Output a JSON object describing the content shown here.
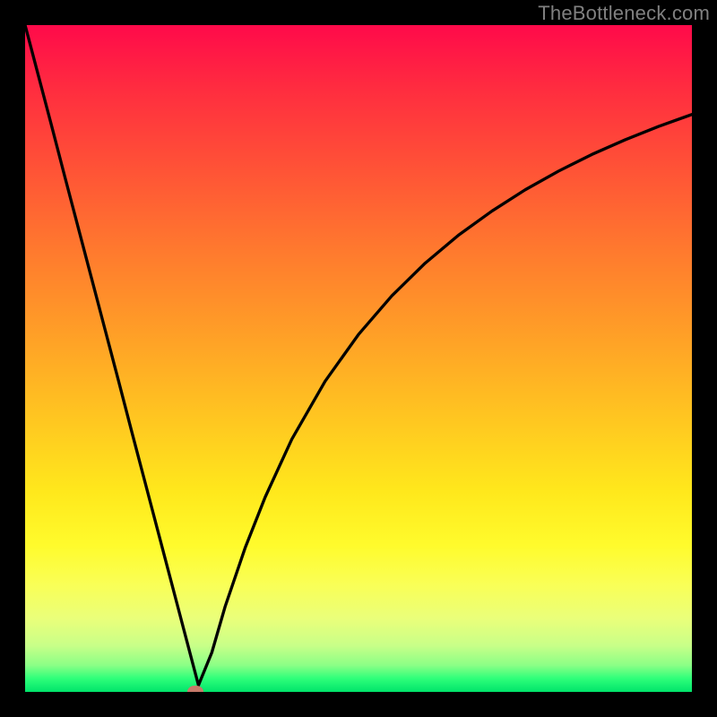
{
  "watermark": "TheBottleneck.com",
  "chart_data": {
    "type": "line",
    "title": "",
    "xlabel": "",
    "ylabel": "",
    "xlim": [
      0,
      100
    ],
    "ylim": [
      0,
      100
    ],
    "x": [
      0,
      2,
      4,
      6,
      8,
      10,
      12,
      14,
      16,
      18,
      20,
      21,
      22,
      23,
      24,
      25,
      26,
      28,
      30,
      33,
      36,
      40,
      45,
      50,
      55,
      60,
      65,
      70,
      75,
      80,
      85,
      90,
      95,
      100
    ],
    "values": [
      100,
      92.4,
      84.8,
      77.1,
      69.5,
      61.9,
      54.3,
      46.7,
      39.0,
      31.4,
      23.8,
      20.0,
      16.2,
      12.4,
      8.6,
      4.8,
      1.0,
      5.9,
      12.8,
      21.6,
      29.2,
      37.9,
      46.6,
      53.6,
      59.4,
      64.3,
      68.5,
      72.1,
      75.3,
      78.1,
      80.6,
      82.8,
      84.8,
      86.6
    ],
    "marker": {
      "x": 25.5,
      "y": 0
    },
    "background_gradient": {
      "top": "#ff0a4a",
      "mid": "#ffc321",
      "bottom": "#00e36a"
    }
  }
}
